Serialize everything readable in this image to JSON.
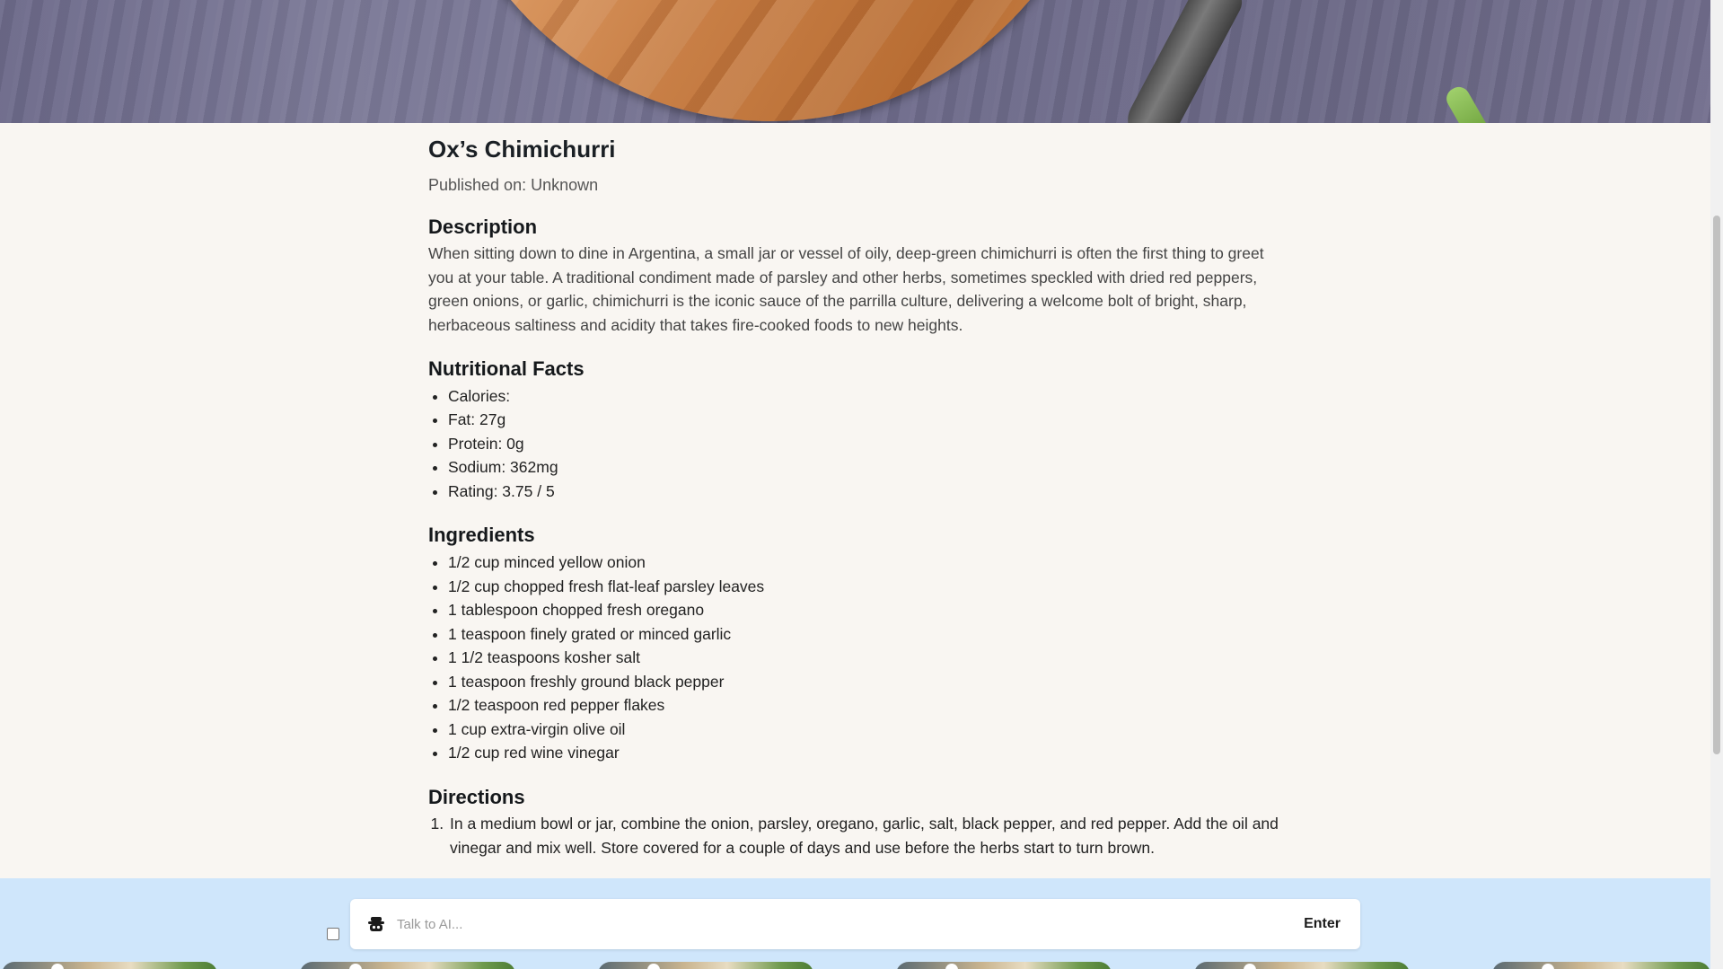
{
  "recipe": {
    "title": "Ox’s Chimichurri",
    "published": "Published on: Unknown"
  },
  "sections": {
    "description": "Description",
    "nutrition": "Nutritional Facts",
    "ingredients": "Ingredients",
    "directions": "Directions"
  },
  "description_text": "When sitting down to dine in Argentina, a small jar or vessel of oily, deep-green chimichurri is often the first thing to greet you at your table. A traditional condiment made of parsley and other herbs, sometimes speckled with dried red peppers, green onions, or garlic, chimichurri is the iconic sauce of the parrilla culture, delivering a welcome bolt of bright, sharp, herbaceous saltiness and acidity that takes fire-cooked foods to new heights.",
  "nutrition": [
    "Calories:",
    "Fat: 27g",
    "Protein: 0g",
    "Sodium: 362mg",
    "Rating: 3.75 / 5"
  ],
  "ingredients": [
    "1/2 cup minced yellow onion",
    "1/2 cup chopped fresh flat-leaf parsley leaves",
    "1 tablespoon chopped fresh oregano",
    "1 teaspoon finely grated or minced garlic",
    "1 1/2 teaspoons kosher salt",
    "1 teaspoon freshly ground black pepper",
    "1/2 teaspoon red pepper flakes",
    "1 cup extra-virgin olive oil",
    "1/2 cup red wine vinegar"
  ],
  "directions": [
    "In a medium bowl or jar, combine the onion, parsley, oregano, garlic, salt, black pepper, and red pepper. Add the oil and vinegar and mix well. Store covered for a couple of days and use before the herbs start to turn brown."
  ],
  "ai_bar": {
    "placeholder": "Talk to AI...",
    "enter_label": "Enter",
    "icon": "robot-icon"
  },
  "colors": {
    "page_bg": "#f9f6f2",
    "ai_band_bg": "#cfe6fb",
    "text": "#1c1c1c"
  }
}
